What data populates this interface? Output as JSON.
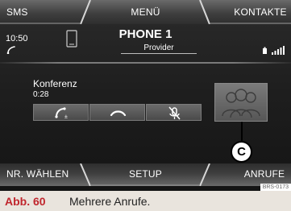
{
  "top_bar": {
    "tabs": [
      {
        "label": "SMS"
      },
      {
        "label": "MENÜ"
      },
      {
        "label": "KONTAKTE"
      }
    ]
  },
  "status": {
    "time": "10:50",
    "phone_name": "PHONE 1",
    "provider": "Provider",
    "icons": [
      "call-status-icon",
      "smartphone-icon",
      "battery-icon",
      "signal-strength-icon"
    ]
  },
  "call": {
    "label": "Konferenz",
    "duration": "0:28",
    "buttons": [
      {
        "name": "conference-call-button",
        "icon": "phone-conference-icon"
      },
      {
        "name": "end-call-button",
        "icon": "hang-up-icon"
      },
      {
        "name": "mute-button",
        "icon": "mute-microphone-icon"
      }
    ],
    "contact_image_icon": "multiple-persons-icon"
  },
  "callout": {
    "label": "C"
  },
  "bottom_bar": {
    "tabs": [
      {
        "label": "NR. WÄHLEN"
      },
      {
        "label": "SETUP"
      },
      {
        "label": "ANRUFE"
      }
    ]
  },
  "image_code": "BRS-0173",
  "caption": {
    "number": "Abb. 60",
    "text": "Mehrere Anrufe."
  },
  "colors": {
    "caption_number": "#c0262d",
    "caption_background": "#e9e4dd",
    "screen_background": "#1f1f1f"
  }
}
